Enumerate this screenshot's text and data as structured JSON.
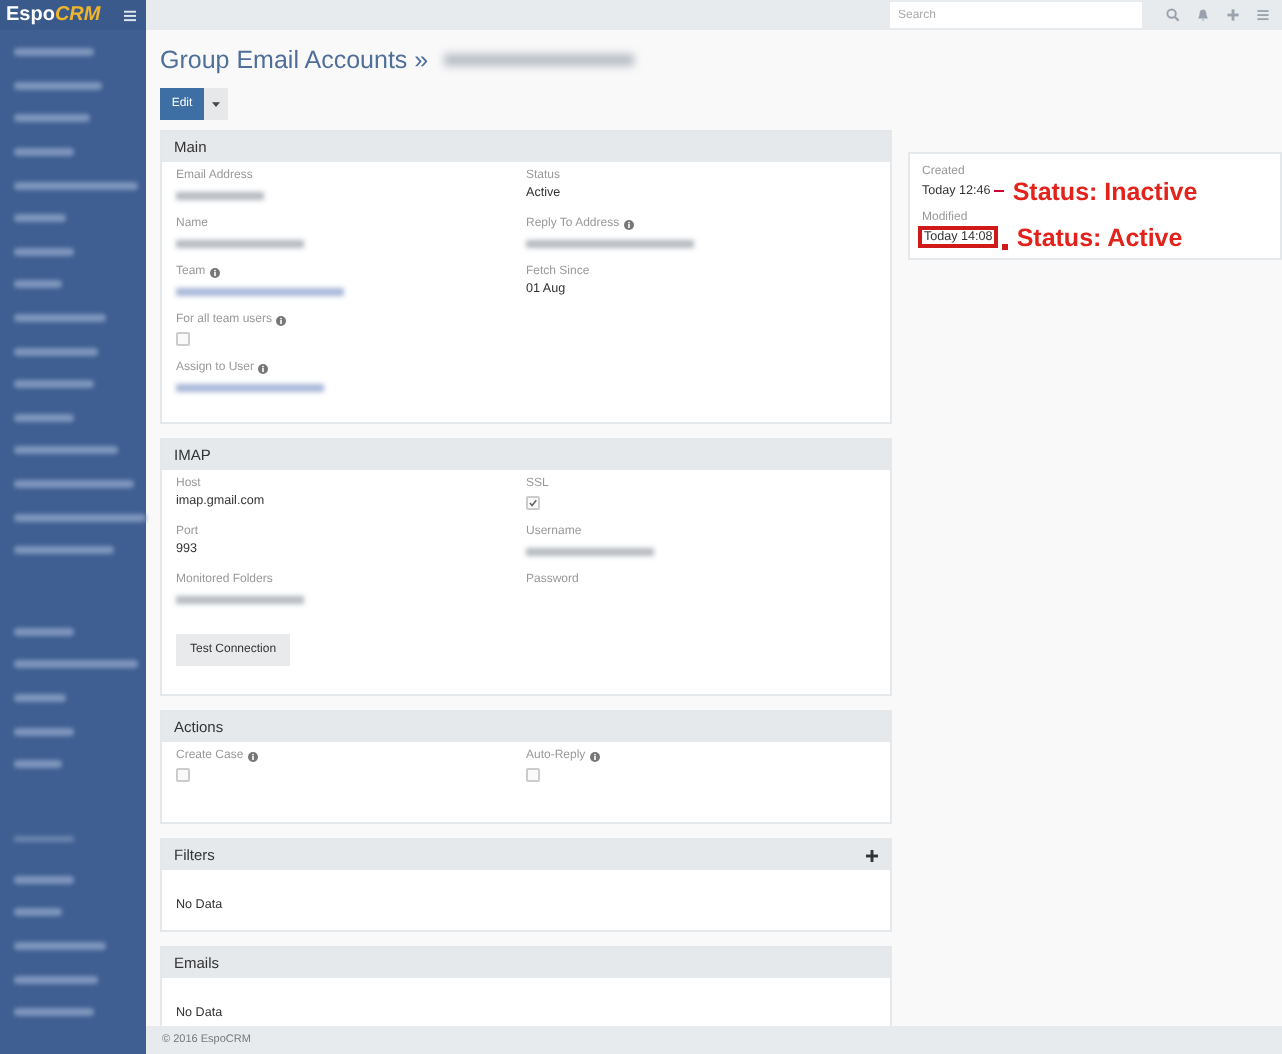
{
  "topbar": {
    "logo_left": "Espo",
    "logo_right": "CRM",
    "search": {
      "placeholder": "Search"
    }
  },
  "header": {
    "title": "Group Email Accounts »"
  },
  "edit_button": "Edit",
  "panels": [
    {
      "title": "Main",
      "left": [
        {
          "label": "Email Address",
          "info": false,
          "kind": "blurred",
          "link": false
        },
        {
          "label": "Name",
          "info": false,
          "kind": "blurred",
          "link": false
        },
        {
          "label": "Team",
          "info": true,
          "kind": "blurred",
          "link": true
        },
        {
          "label": "For all team users",
          "info": true,
          "kind": "checkbox",
          "checked": false
        },
        {
          "label": "Assign to User",
          "info": true,
          "kind": "blurred",
          "link": true
        }
      ],
      "right": [
        {
          "label": "Status",
          "info": false,
          "kind": "text",
          "value": "Active"
        },
        {
          "label": "Reply To Address",
          "info": true,
          "kind": "blurred",
          "link": false
        },
        {
          "label": "Fetch Since",
          "info": false,
          "kind": "text",
          "value": "01 Aug"
        }
      ]
    },
    {
      "title": "IMAP",
      "left": [
        {
          "label": "Host",
          "info": false,
          "kind": "text",
          "value": "imap.gmail.com"
        },
        {
          "label": "Port",
          "info": false,
          "kind": "text",
          "value": "993"
        },
        {
          "label": "Monitored Folders",
          "info": false,
          "kind": "blurred",
          "link": false
        }
      ],
      "right": [
        {
          "label": "SSL",
          "info": false,
          "kind": "checkbox",
          "checked": true
        },
        {
          "label": "Username",
          "info": false,
          "kind": "blurred",
          "link": false
        },
        {
          "label": "Password",
          "info": false,
          "kind": "empty"
        }
      ],
      "button": "Test Connection"
    },
    {
      "title": "Actions",
      "left": [
        {
          "label": "Create Case",
          "info": true,
          "kind": "checkbox",
          "checked": false
        }
      ],
      "right": [
        {
          "label": "Auto-Reply",
          "info": true,
          "kind": "checkbox",
          "checked": false
        }
      ]
    },
    {
      "title": "Filters",
      "plus": true,
      "empty_text": "No Data"
    },
    {
      "title": "Emails",
      "plus": false,
      "empty_text": "No Data"
    }
  ],
  "side_panel": {
    "created_label": "Created",
    "created": "Today 12:46",
    "modified_label": "Modified",
    "modified": "Today 14:08",
    "modified_highlighted": true
  },
  "annotations": [
    {
      "text": "Status: Inactive"
    },
    {
      "text": "Status: Active"
    }
  ],
  "footer": "© 2016 EspoCRM"
}
